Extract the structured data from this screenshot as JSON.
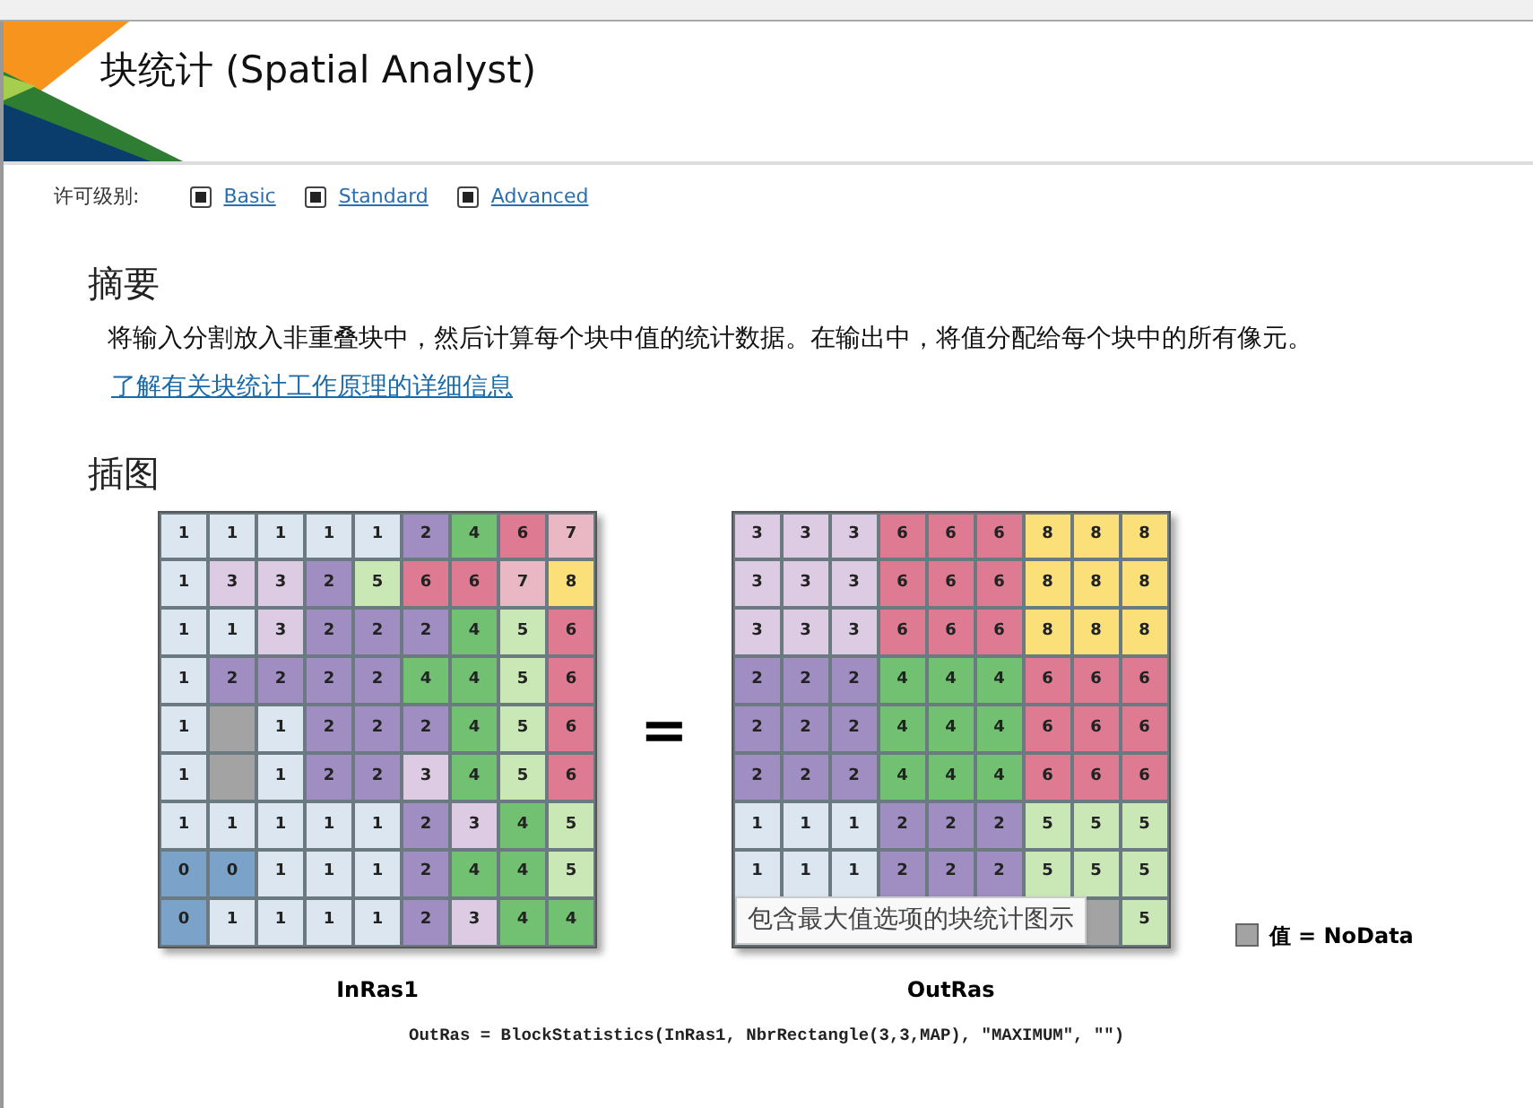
{
  "title": "块统计 (Spatial Analyst)",
  "license": {
    "label": "许可级别:",
    "levels": [
      {
        "name": "Basic",
        "checked": true
      },
      {
        "name": "Standard",
        "checked": true
      },
      {
        "name": "Advanced",
        "checked": true
      }
    ]
  },
  "summary": {
    "heading": "摘要",
    "text": "将输入分割放入非重叠块中，然后计算每个块中值的统计数据。在输出中，将值分配给每个块中的所有像元。",
    "link": "了解有关块统计工作原理的详细信息"
  },
  "illustration": {
    "heading": "插图",
    "input": {
      "label": "InRas1",
      "rows": [
        [
          "1",
          "1",
          "1",
          "1",
          "1",
          "2",
          "4",
          "6",
          "7"
        ],
        [
          "1",
          "3",
          "3",
          "2",
          "5",
          "6",
          "6",
          "7",
          "8"
        ],
        [
          "1",
          "1",
          "3",
          "2",
          "2",
          "2",
          "4",
          "5",
          "6"
        ],
        [
          "1",
          "2",
          "2",
          "2",
          "2",
          "4",
          "4",
          "5",
          "6"
        ],
        [
          "1",
          null,
          "1",
          "2",
          "2",
          "2",
          "4",
          "5",
          "6"
        ],
        [
          "1",
          null,
          "1",
          "2",
          "2",
          "3",
          "4",
          "5",
          "6"
        ],
        [
          "1",
          "1",
          "1",
          "1",
          "1",
          "2",
          "3",
          "4",
          "5"
        ],
        [
          "0",
          "0",
          "1",
          "1",
          "1",
          "2",
          "4",
          "4",
          "5"
        ],
        [
          "0",
          "1",
          "1",
          "1",
          "1",
          "2",
          "3",
          "4",
          "4"
        ]
      ]
    },
    "operator": "=",
    "output": {
      "label": "OutRas",
      "rows": [
        [
          "3",
          "3",
          "3",
          "6",
          "6",
          "6",
          "8",
          "8",
          "8"
        ],
        [
          "3",
          "3",
          "3",
          "6",
          "6",
          "6",
          "8",
          "8",
          "8"
        ],
        [
          "3",
          "3",
          "3",
          "6",
          "6",
          "6",
          "8",
          "8",
          "8"
        ],
        [
          "2",
          "2",
          "2",
          "4",
          "4",
          "4",
          "6",
          "6",
          "6"
        ],
        [
          "2",
          "2",
          "2",
          "4",
          "4",
          "4",
          "6",
          "6",
          "6"
        ],
        [
          "2",
          "2",
          "2",
          "4",
          "4",
          "4",
          "6",
          "6",
          "6"
        ],
        [
          "1",
          "1",
          "1",
          "2",
          "2",
          "2",
          "5",
          "5",
          "5"
        ],
        [
          "1",
          "1",
          "1",
          "2",
          "2",
          "2",
          "5",
          "5",
          "5"
        ],
        [
          null,
          null,
          null,
          null,
          null,
          null,
          null,
          null,
          "5"
        ]
      ]
    },
    "tooltip": "包含最大值选项的块统计图示",
    "legend": "值 = NoData",
    "code": "OutRas = BlockStatistics(InRas1, NbrRectangle(3,3,MAP), \"MAXIMUM\", \"\")"
  }
}
